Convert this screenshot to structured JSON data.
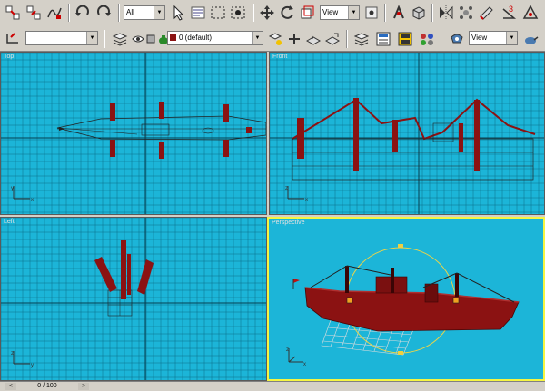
{
  "toolbar": {
    "selection_filter": "All",
    "ref_coord": "View",
    "ref_coord2": "View",
    "snap_label": "3",
    "layer": "0 (default)"
  },
  "viewports": {
    "top": "Top",
    "front": "Front",
    "left": "Left",
    "perspective": "Perspective"
  },
  "timeline": {
    "frame": "0 / 100",
    "prev": "<",
    "next": ">"
  },
  "colors": {
    "viewport_bg": "#1cb5d8",
    "grid_line": "#0a6f8a",
    "model": "#8b1212",
    "active_border": "#f5f542"
  },
  "icons": [
    "select-link-icon",
    "unlink-icon",
    "bind-space-warp-icon",
    "undo-icon",
    "redo-icon",
    "select-object-icon",
    "select-by-name-icon",
    "rectangle-region-icon",
    "window-crossing-icon",
    "move-icon",
    "rotate-icon",
    "scale-icon",
    "use-pivot-icon",
    "select-manipulate-icon",
    "snap-toggle-icon",
    "angle-snap-icon",
    "mirror-icon",
    "align-icon",
    "layer-manager-icon",
    "curve-editor-icon",
    "schematic-icon",
    "material-editor-icon",
    "render-setup-icon",
    "quick-render-icon",
    "axis-constraint-icon",
    "layer-icon",
    "eye-icon",
    "teapot-icon"
  ]
}
